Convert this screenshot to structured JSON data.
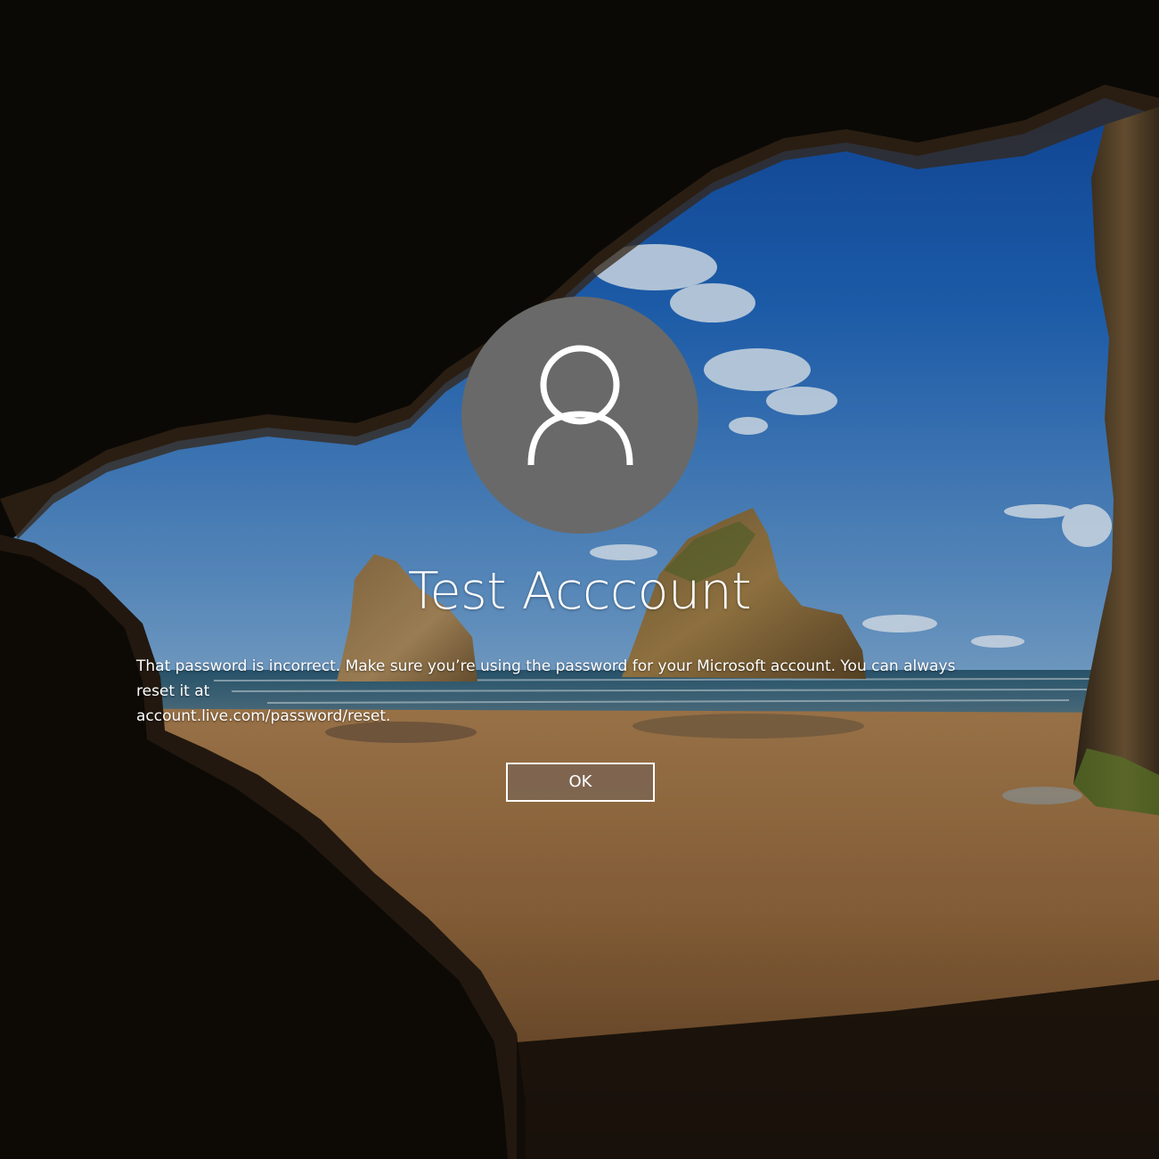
{
  "lock_screen": {
    "account_name": "Test Acccount",
    "error_message_lines": [
      "That password is incorrect. Make sure you’re using the password for your Microsoft account. You can always",
      "reset it at",
      "account.live.com/password/reset."
    ],
    "ok_button_label": "OK",
    "avatar_icon": "user-icon"
  },
  "colors": {
    "avatar_background": "#696969",
    "text": "#ffffff",
    "button_background": "#786454",
    "button_border": "#ffffff"
  }
}
